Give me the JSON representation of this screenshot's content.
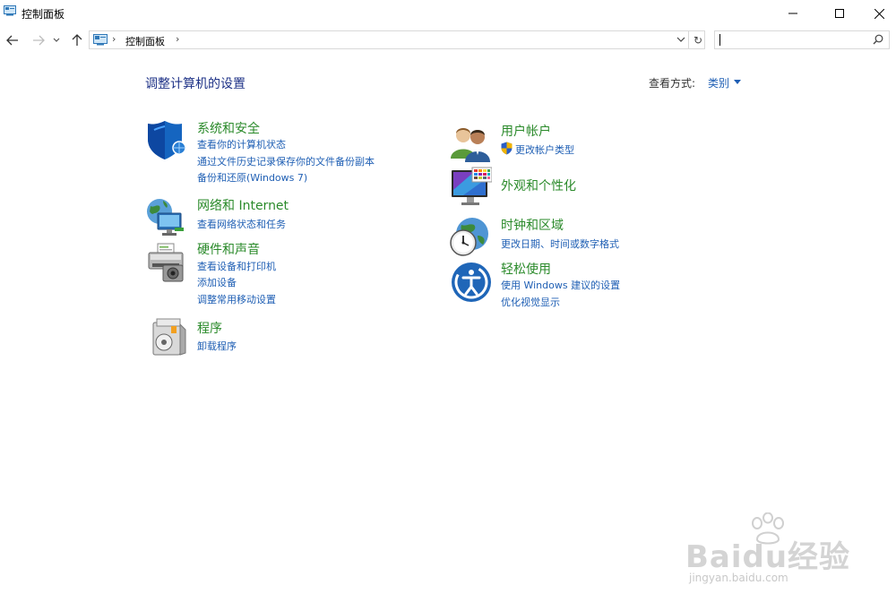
{
  "window": {
    "title": "控制面板"
  },
  "address": {
    "breadcrumb": "控制面板",
    "search_placeholder": ""
  },
  "main": {
    "heading": "调整计算机的设置",
    "view_by_label": "查看方式:",
    "view_by_value": "类别"
  },
  "categories_left": [
    {
      "title": "系统和安全",
      "icon": "shield-icon",
      "links": [
        "查看你的计算机状态",
        "通过文件历史记录保存你的文件备份副本",
        "备份和还原(Windows 7)"
      ]
    },
    {
      "title": "网络和 Internet",
      "icon": "network-globe-icon",
      "links": [
        "查看网络状态和任务"
      ]
    },
    {
      "title": "硬件和声音",
      "icon": "printer-icon",
      "links": [
        "查看设备和打印机",
        "添加设备",
        "调整常用移动设置"
      ]
    },
    {
      "title": "程序",
      "icon": "programs-disc-icon",
      "links": [
        "卸载程序"
      ]
    }
  ],
  "categories_right": [
    {
      "title": "用户帐户",
      "icon": "users-icon",
      "links": [
        "更改帐户类型"
      ]
    },
    {
      "title": "外观和个性化",
      "icon": "monitor-palette-icon",
      "links": []
    },
    {
      "title": "时钟和区域",
      "icon": "clock-globe-icon",
      "links": [
        "更改日期、时间或数字格式"
      ]
    },
    {
      "title": "轻松使用",
      "icon": "ease-of-access-icon",
      "links": [
        "使用 Windows 建议的设置",
        "优化视觉显示"
      ]
    }
  ],
  "watermark": {
    "brand": "Baidu经验",
    "url": "jingyan.baidu.com"
  },
  "colors": {
    "heading": "#1e3287",
    "category_title": "#2a8a2a",
    "link": "#1f5fb4"
  }
}
